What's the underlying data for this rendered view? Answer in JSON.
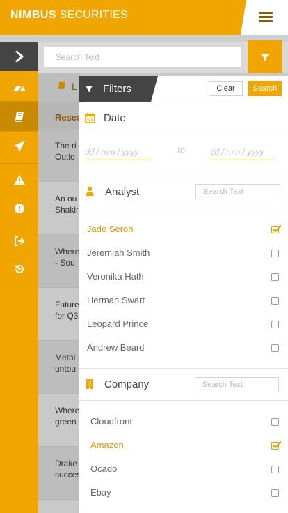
{
  "header": {
    "brand_bold": "NIMBUS",
    "brand_light": "SECURITIES",
    "menu_icon": "hamburger-icon"
  },
  "search": {
    "placeholder": "Search Text",
    "filter_icon": "funnel-icon"
  },
  "sidebar": {
    "toggle_icon": "chevron-right-icon",
    "items": [
      {
        "icon": "dashboard-gauge-icon",
        "active": false
      },
      {
        "icon": "book-icon",
        "active": true
      },
      {
        "icon": "plane-icon",
        "active": false
      },
      {
        "icon": "warning-triangle-icon",
        "active": false
      },
      {
        "icon": "exclamation-circle-icon",
        "active": false
      },
      {
        "icon": "sign-out-icon",
        "active": false
      },
      {
        "icon": "reset-icon",
        "active": false
      }
    ]
  },
  "background_list": {
    "header_label": "L",
    "column_label": "Resea",
    "rows": [
      [
        "The ri",
        "Outlo"
      ],
      [
        "An ou",
        "Shakin"
      ],
      [
        "Where",
        "- Sou"
      ],
      [
        "Future",
        "for Q3"
      ],
      [
        "Metal",
        "untou"
      ],
      [
        "Where",
        "green"
      ],
      [
        "Drake",
        "succes"
      ]
    ]
  },
  "filters": {
    "title": "Filters",
    "clear_label": "Clear",
    "search_label": "Search",
    "date": {
      "label": "Date",
      "from_placeholder": "dd / mm / yyyy",
      "to_label": "to",
      "to_placeholder": "dd / mm / yyyy"
    },
    "analyst": {
      "label": "Analyst",
      "search_placeholder": "Search Text",
      "options": [
        {
          "label": "Jade Seron",
          "checked": true
        },
        {
          "label": "Jeremiah Smith",
          "checked": false
        },
        {
          "label": "Veronika Hath",
          "checked": false
        },
        {
          "label": "Herman Swart",
          "checked": false
        },
        {
          "label": "Leopard Prince",
          "checked": false
        },
        {
          "label": "Andrew Beard",
          "checked": false
        }
      ]
    },
    "company": {
      "label": "Company",
      "search_placeholder": "Search Text",
      "options": [
        {
          "label": "Cloudfront",
          "checked": false
        },
        {
          "label": "Amazon",
          "checked": true
        },
        {
          "label": "Ocado",
          "checked": false
        },
        {
          "label": "Ebay",
          "checked": false
        }
      ]
    }
  },
  "colors": {
    "accent": "#f0a500",
    "dark": "#444444",
    "selected_text": "#d99700"
  }
}
